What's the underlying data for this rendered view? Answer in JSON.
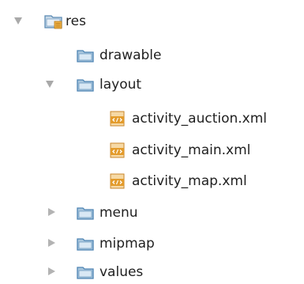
{
  "tree": {
    "root": {
      "label": "res",
      "icon": "resource-folder-icon",
      "expanded": true
    },
    "drawable": {
      "label": "drawable",
      "icon": "folder-icon"
    },
    "layout": {
      "label": "layout",
      "icon": "folder-icon",
      "expanded": true,
      "files": [
        {
          "label": "activity_auction.xml",
          "icon": "xml-file-icon"
        },
        {
          "label": "activity_main.xml",
          "icon": "xml-file-icon"
        },
        {
          "label": "activity_map.xml",
          "icon": "xml-file-icon"
        }
      ]
    },
    "menu": {
      "label": "menu",
      "icon": "folder-icon",
      "expanded": false
    },
    "mipmap": {
      "label": "mipmap",
      "icon": "folder-icon",
      "expanded": false
    },
    "values": {
      "label": "values",
      "icon": "folder-icon",
      "expanded": false
    }
  },
  "colors": {
    "folder_fill": "#a8c6dd",
    "folder_border": "#4d84b3",
    "resource_folder_accent": "#e8a33d",
    "xml_file_accent": "#e39b2b"
  }
}
